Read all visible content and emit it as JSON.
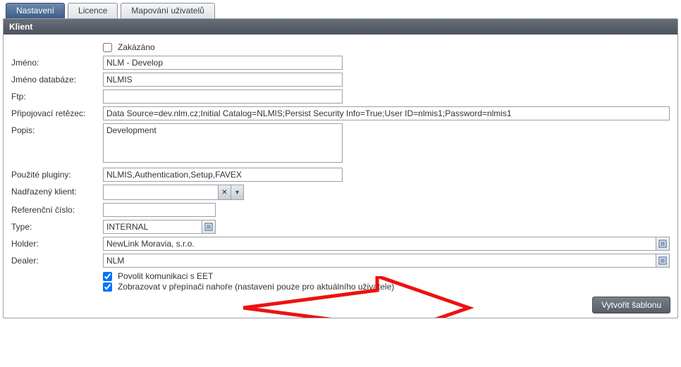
{
  "tabs": {
    "items": [
      {
        "label": "Nastavení",
        "active": true
      },
      {
        "label": "Licence",
        "active": false
      },
      {
        "label": "Mapování uživatelů",
        "active": false
      }
    ]
  },
  "panel": {
    "title": "Klient"
  },
  "form": {
    "disabled_label": "Zakázáno",
    "disabled_checked": false,
    "rows": {
      "jmeno": {
        "label": "Jméno:",
        "value": "NLM - Develop"
      },
      "db": {
        "label": "Jméno databáze:",
        "value": "NLMIS"
      },
      "ftp": {
        "label": "Ftp:",
        "value": ""
      },
      "conn": {
        "label": "Připojovací retězec:",
        "value": "Data Source=dev.nlm.cz;Initial Catalog=NLMIS;Persist Security Info=True;User ID=nlmis1;Password=nlmis1"
      },
      "popis": {
        "label": "Popis:",
        "value": "Development"
      },
      "plugins": {
        "label": "Použité pluginy:",
        "value": "NLMIS,Authentication,Setup,FAVEX"
      },
      "parent": {
        "label": "Nadřazený klient:",
        "value": ""
      },
      "refnum": {
        "label": "Referenční číslo:",
        "value": ""
      },
      "type": {
        "label": "Type:",
        "value": "INTERNAL"
      },
      "holder": {
        "label": "Holder:",
        "value": "NewLink Moravia, s.r.o."
      },
      "dealer": {
        "label": "Dealer:",
        "value": "NLM"
      }
    },
    "eet": {
      "label": "Povolit komunikaci s EET",
      "checked": true
    },
    "switcher": {
      "label": "Zobrazovat v přepínači nahoře (nastavení pouze pro aktuálního uživatele)",
      "checked": true
    }
  },
  "footer": {
    "create_template": "Vytvořit šablonu"
  }
}
